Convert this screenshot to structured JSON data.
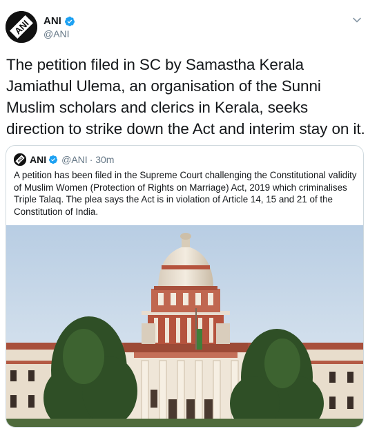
{
  "tweet": {
    "author_name": "ANI",
    "author_handle": "@ANI",
    "avatar_logo": "ANI",
    "text": "The petition filed in SC by Samastha Kerala Jamiathul Ulema, an organisation of the Sunni Muslim scholars and clerics in Kerala, seeks direction to strike down the Act and interim stay on it.",
    "menu_icon": "chevron-down-icon",
    "verified_icon": "verified-badge-icon"
  },
  "quoted_tweet": {
    "author_name": "ANI",
    "author_handle": "@ANI",
    "time": "· 30m",
    "text": "A petition has been filed in the Supreme Court challenging the Constitutional validity of Muslim Women (Protection of Rights on Marriage) Act, 2019 which criminalises Triple Talaq. The plea says the Act is in violation of Article 14, 15 and 21 of the Constitution of India.",
    "media": "supreme-court-building-photo"
  },
  "colors": {
    "verified_blue": "#1da1f2",
    "secondary_text": "#657786",
    "border": "#cfd9de"
  }
}
